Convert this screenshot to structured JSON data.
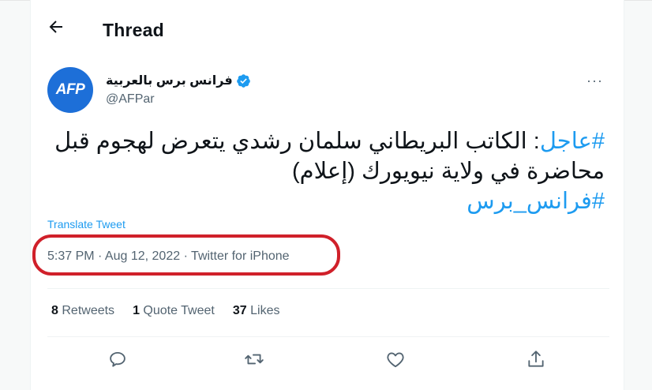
{
  "header": {
    "title": "Thread",
    "back_icon": "arrow-left-icon"
  },
  "author": {
    "avatar_text": "AFP",
    "display_name": "فرانس برس بالعربية",
    "handle": "@AFPar",
    "verified": true
  },
  "tweet": {
    "hashtag1": "#عاجل",
    "body": ": الكاتب البريطاني سلمان رشدي يتعرض لهجوم قبل محاضرة في ولاية نيويورك (إعلام)",
    "hashtag2": "#فرانس_برس",
    "translate_label": "Translate Tweet",
    "meta": "5:37 PM · Aug 12, 2022 · Twitter for iPhone"
  },
  "stats": {
    "retweets_count": "8",
    "retweets_label": "Retweets",
    "quotes_count": "1",
    "quotes_label": "Quote Tweet",
    "likes_count": "37",
    "likes_label": "Likes"
  },
  "colors": {
    "accent": "#1d9bf0",
    "highlight": "#d0202a",
    "avatar": "#1d6fd8"
  }
}
